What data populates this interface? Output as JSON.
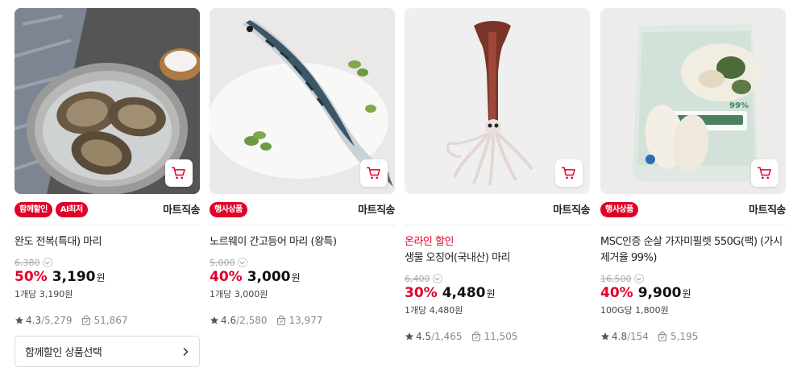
{
  "currency_unit": "원",
  "products": [
    {
      "image": "abalone-photo",
      "badges": [
        "함께할인",
        "AI최저"
      ],
      "seller": "마트직송",
      "promo": "",
      "name": "완도 전복(특대) 마리",
      "original_price": "6,380",
      "discount": "50%",
      "price": "3,190",
      "unit_price": "1개당 3,190원",
      "rating": "4.3",
      "review_count": "5,279",
      "purchase_count": "51,867",
      "combo_button": "함께할인 상품선택"
    },
    {
      "image": "mackerel-photo",
      "badges": [
        "행사상품"
      ],
      "seller": "마트직송",
      "promo": "",
      "name": "노르웨이 간고등어 마리 (왕특)",
      "original_price": "5,000",
      "discount": "40%",
      "price": "3,000",
      "unit_price": "1개당 3,000원",
      "rating": "4.6",
      "review_count": "2,580",
      "purchase_count": "13,977"
    },
    {
      "image": "squid-photo",
      "badges": [],
      "seller": "마트직송",
      "promo": "온라인 할인",
      "name": "생물 오징어(국내산) 마리",
      "original_price": "6,400",
      "discount": "30%",
      "price": "4,480",
      "unit_price": "1개당 4,480원",
      "rating": "4.5",
      "review_count": "1,465",
      "purchase_count": "11,505"
    },
    {
      "image": "fish-fillet-package-photo",
      "badges": [
        "행사상품"
      ],
      "seller": "마트직송",
      "promo": "",
      "name": "MSC인증 순살 가자미필렛 550G(팩) (가시제거율 99%)",
      "original_price": "16,500",
      "discount": "40%",
      "price": "9,900",
      "unit_price": "100G당 1,800원",
      "rating": "4.8",
      "review_count": "154",
      "purchase_count": "5,195"
    }
  ],
  "icons": {
    "cart": "cart-icon",
    "star": "star-icon",
    "purchases": "shopping-bag-icon",
    "info": "chevron-down-icon",
    "arrow": "chevron-right-icon"
  },
  "colors": {
    "accent": "#e0002a",
    "text": "#222222",
    "muted": "#888888"
  }
}
